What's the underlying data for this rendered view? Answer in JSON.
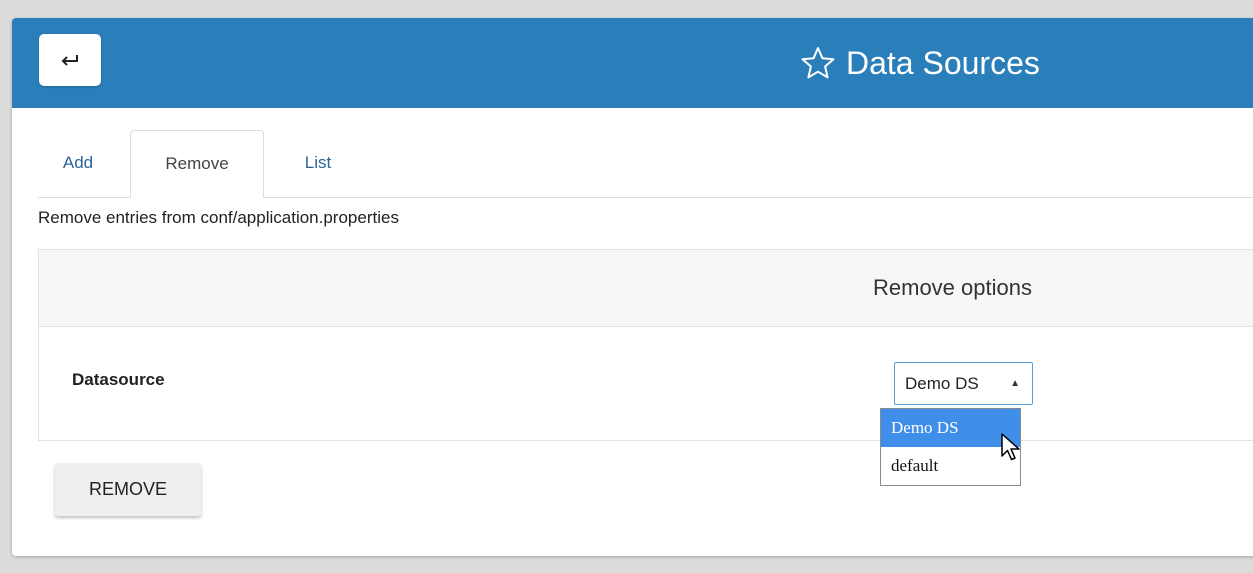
{
  "header": {
    "title": "Data Sources",
    "back_icon": "return-arrow-icon",
    "title_icon": "star-icon",
    "background_color": "#2a7fba"
  },
  "tabs": [
    {
      "label": "Add",
      "active": false
    },
    {
      "label": "Remove",
      "active": true
    },
    {
      "label": "List",
      "active": false
    }
  ],
  "description": "Remove entries from conf/application.properties",
  "panel": {
    "title": "Remove options",
    "field_label": "Datasource",
    "select": {
      "value": "Demo DS",
      "options": [
        {
          "label": "Demo DS",
          "selected": true
        },
        {
          "label": "default",
          "selected": false
        }
      ]
    }
  },
  "actions": {
    "remove_label": "REMOVE"
  },
  "colors": {
    "link": "#2a6496",
    "selected_option": "#3f8ee9"
  }
}
